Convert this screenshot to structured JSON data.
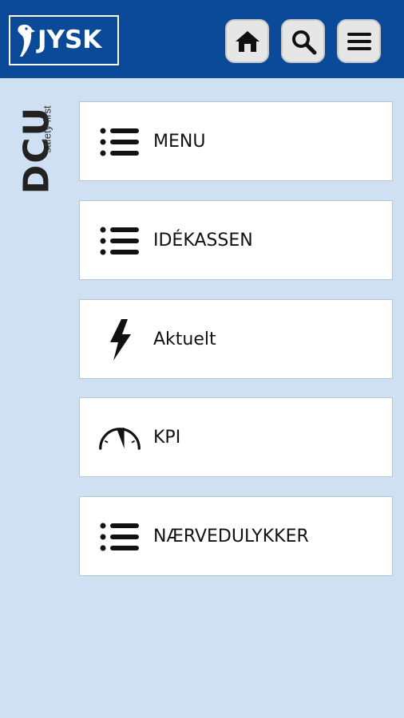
{
  "header": {
    "logo_text": "JYSK",
    "buttons": [
      {
        "icon": "home-icon"
      },
      {
        "icon": "search-icon"
      },
      {
        "icon": "hamburger-menu-icon"
      }
    ]
  },
  "brand": {
    "title": "DCU",
    "tagline": "safety first"
  },
  "tiles": [
    {
      "label": "MENU",
      "icon": "list-icon"
    },
    {
      "label": "IDÉKASSEN",
      "icon": "list-icon"
    },
    {
      "label": "Aktuelt",
      "icon": "lightning-bolt-icon"
    },
    {
      "label": "KPI",
      "icon": "gauge-icon"
    },
    {
      "label": "NÆRVEDULYKKER",
      "icon": "list-icon"
    }
  ],
  "colors": {
    "header_bg": "#0b4a98",
    "page_bg": "#cfe0f3",
    "tile_bg": "#ffffff"
  }
}
